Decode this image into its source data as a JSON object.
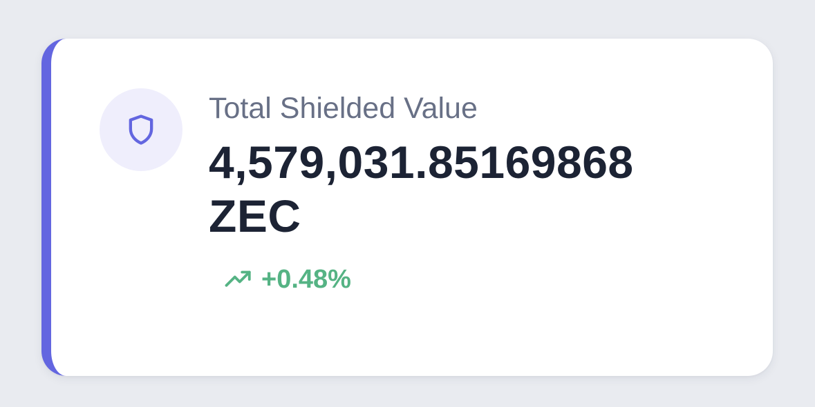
{
  "card": {
    "label": "Total Shielded Value",
    "value_amount": "4,579,031.85169868",
    "value_unit": "ZEC",
    "change": "+0.48%",
    "icon": "shield-icon",
    "trend_icon": "trending-up-icon"
  },
  "colors": {
    "accent": "#6366e0",
    "icon_bg": "#efeefc",
    "label": "#687086",
    "value": "#1c2334",
    "positive": "#55b384",
    "page_bg": "#e9ebf0"
  }
}
